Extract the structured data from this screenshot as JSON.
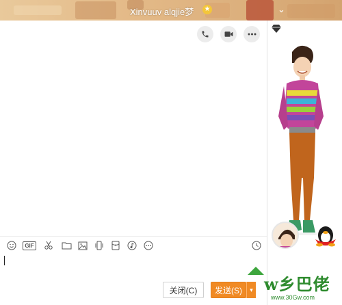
{
  "window": {
    "title": "Xinvuuv alqjie梦",
    "vip_badge": "★"
  },
  "actions": {
    "phone": "phone-icon",
    "video": "video-icon",
    "more": "more-icon"
  },
  "toolbar": {
    "gif_label": "GIF",
    "items": [
      "emoji-icon",
      "gif-icon",
      "scissors-icon",
      "folder-icon",
      "image-icon",
      "shake-icon",
      "doc-icon",
      "music-icon",
      "more-tools-icon",
      "history-icon"
    ]
  },
  "buttons": {
    "close_label": "关闭(C)",
    "send_label": "发送(S)",
    "send_arrow": "▾"
  },
  "watermark": {
    "main": "w乡巴佬",
    "sub": "www.30Gw.com"
  },
  "colors": {
    "accent": "#f08a24",
    "watermark": "#2e8b2e"
  }
}
